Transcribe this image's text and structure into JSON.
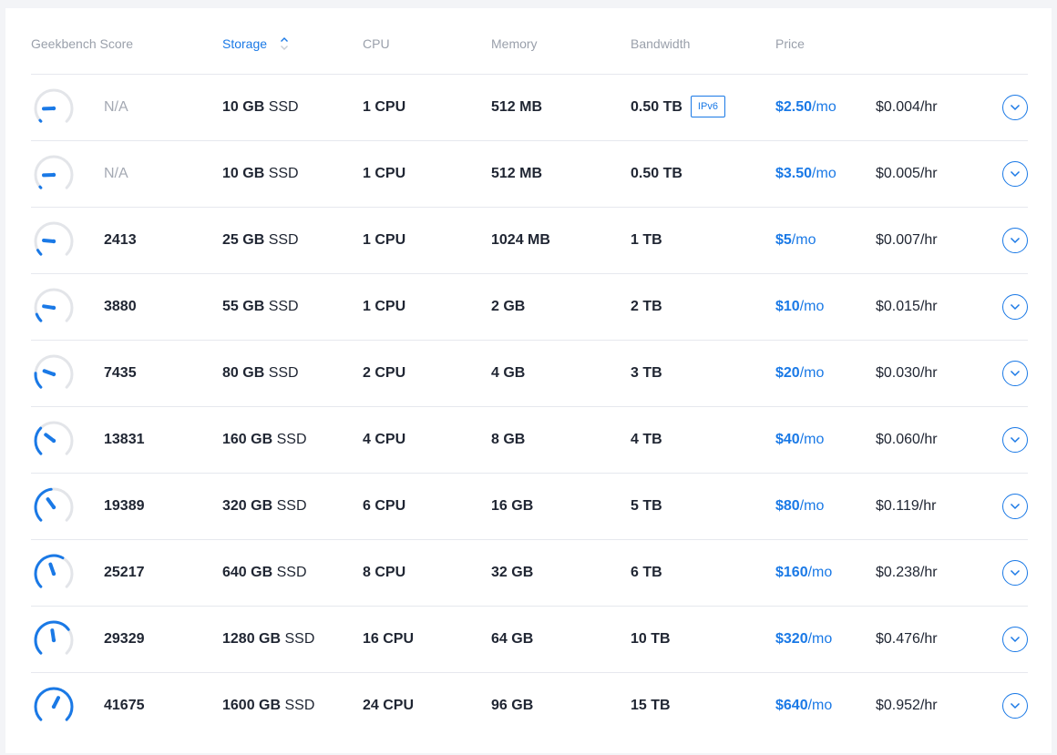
{
  "colors": {
    "accent": "#1a79e6",
    "gauge_track": "#e3e5e9",
    "border": "#e6e8ee"
  },
  "headers": {
    "score": "Geekbench Score",
    "storage": "Storage",
    "cpu": "CPU",
    "memory": "Memory",
    "bandwidth": "Bandwidth",
    "price": "Price"
  },
  "sort": {
    "column": "storage",
    "icon": "sort-chevrons-icon"
  },
  "rows": [
    {
      "score": "N/A",
      "gauge": 0.0,
      "storage_amt": "10 GB",
      "storage_type": "SSD",
      "cpu": "1 CPU",
      "memory": "512 MB",
      "bandwidth": "0.50 TB",
      "badge": "IPv6",
      "price_amt": "$2.50",
      "price_unit": "/mo",
      "hourly": "$0.004/hr"
    },
    {
      "score": "N/A",
      "gauge": 0.0,
      "storage_amt": "10 GB",
      "storage_type": "SSD",
      "cpu": "1 CPU",
      "memory": "512 MB",
      "bandwidth": "0.50 TB",
      "badge": "",
      "price_amt": "$3.50",
      "price_unit": "/mo",
      "hourly": "$0.005/hr"
    },
    {
      "score": "2413",
      "gauge": 0.06,
      "storage_amt": "25 GB",
      "storage_type": "SSD",
      "cpu": "1 CPU",
      "memory": "1024 MB",
      "bandwidth": "1 TB",
      "badge": "",
      "price_amt": "$5",
      "price_unit": "/mo",
      "hourly": "$0.007/hr"
    },
    {
      "score": "3880",
      "gauge": 0.09,
      "storage_amt": "55 GB",
      "storage_type": "SSD",
      "cpu": "1 CPU",
      "memory": "2 GB",
      "bandwidth": "2 TB",
      "badge": "",
      "price_amt": "$10",
      "price_unit": "/mo",
      "hourly": "$0.015/hr"
    },
    {
      "score": "7435",
      "gauge": 0.18,
      "storage_amt": "80 GB",
      "storage_type": "SSD",
      "cpu": "2 CPU",
      "memory": "4 GB",
      "bandwidth": "3 TB",
      "badge": "",
      "price_amt": "$20",
      "price_unit": "/mo",
      "hourly": "$0.030/hr"
    },
    {
      "score": "13831",
      "gauge": 0.33,
      "storage_amt": "160 GB",
      "storage_type": "SSD",
      "cpu": "4 CPU",
      "memory": "8 GB",
      "bandwidth": "4 TB",
      "badge": "",
      "price_amt": "$40",
      "price_unit": "/mo",
      "hourly": "$0.060/hr"
    },
    {
      "score": "19389",
      "gauge": 0.47,
      "storage_amt": "320 GB",
      "storage_type": "SSD",
      "cpu": "6 CPU",
      "memory": "16 GB",
      "bandwidth": "5 TB",
      "badge": "",
      "price_amt": "$80",
      "price_unit": "/mo",
      "hourly": "$0.119/hr"
    },
    {
      "score": "25217",
      "gauge": 0.61,
      "storage_amt": "640 GB",
      "storage_type": "SSD",
      "cpu": "8 CPU",
      "memory": "32 GB",
      "bandwidth": "6 TB",
      "badge": "",
      "price_amt": "$160",
      "price_unit": "/mo",
      "hourly": "$0.238/hr"
    },
    {
      "score": "29329",
      "gauge": 0.7,
      "storage_amt": "1280 GB",
      "storage_type": "SSD",
      "cpu": "16 CPU",
      "memory": "64 GB",
      "bandwidth": "10 TB",
      "badge": "",
      "price_amt": "$320",
      "price_unit": "/mo",
      "hourly": "$0.476/hr"
    },
    {
      "score": "41675",
      "gauge": 1.0,
      "storage_amt": "1600 GB",
      "storage_type": "SSD",
      "cpu": "24 CPU",
      "memory": "96 GB",
      "bandwidth": "15 TB",
      "badge": "",
      "price_amt": "$640",
      "price_unit": "/mo",
      "hourly": "$0.952/hr"
    }
  ],
  "row_action_icon": "chevron-down-icon"
}
